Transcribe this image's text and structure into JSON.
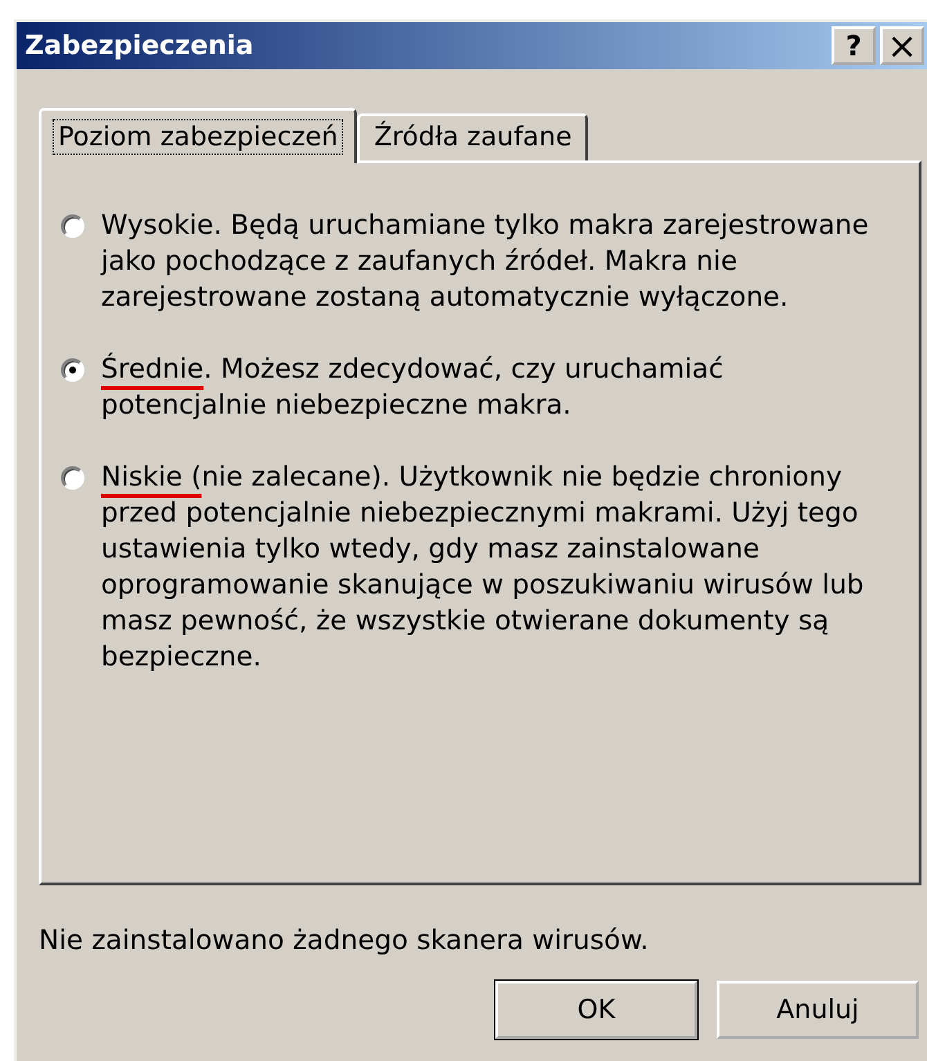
{
  "window": {
    "title": "Zabezpieczenia",
    "buttons": [
      {
        "kind": "help",
        "label": "?"
      },
      {
        "kind": "close",
        "label": "×"
      }
    ]
  },
  "tabs": [
    {
      "label": "Poziom zabezpieczeń",
      "selected": true
    },
    {
      "label": "Źródła zaufane",
      "selected": false
    }
  ],
  "options": [
    {
      "name": "Wysokie",
      "text": ". Będą uruchamiane tylko makra zarejestrowane jako pochodzące z zaufanych źródeł. Makra nie zarejestrowane zostaną automatycznie wyłączone.",
      "selected": false,
      "annotated": false
    },
    {
      "name": "Średnie",
      "text": ". Możesz zdecydować, czy uruchamiać potencjalnie niebezpieczne makra.",
      "selected": true,
      "annotated": true
    },
    {
      "name": "Niskie (",
      "text": "nie zalecane). Użytkownik nie będzie chroniony przed potencjalnie niebezpiecznymi makrami. Użyj tego ustawienia tylko wtedy, gdy masz zainstalowane oprogramowanie skanujące w poszukiwaniu wirusów lub masz pewność, że wszystkie otwierane dokumenty są bezpieczne.",
      "selected": false,
      "annotated": true
    }
  ],
  "status": "Nie zainstalowano żadnego skanera wirusów.",
  "buttons": [
    "OK",
    "Anuluj"
  ]
}
